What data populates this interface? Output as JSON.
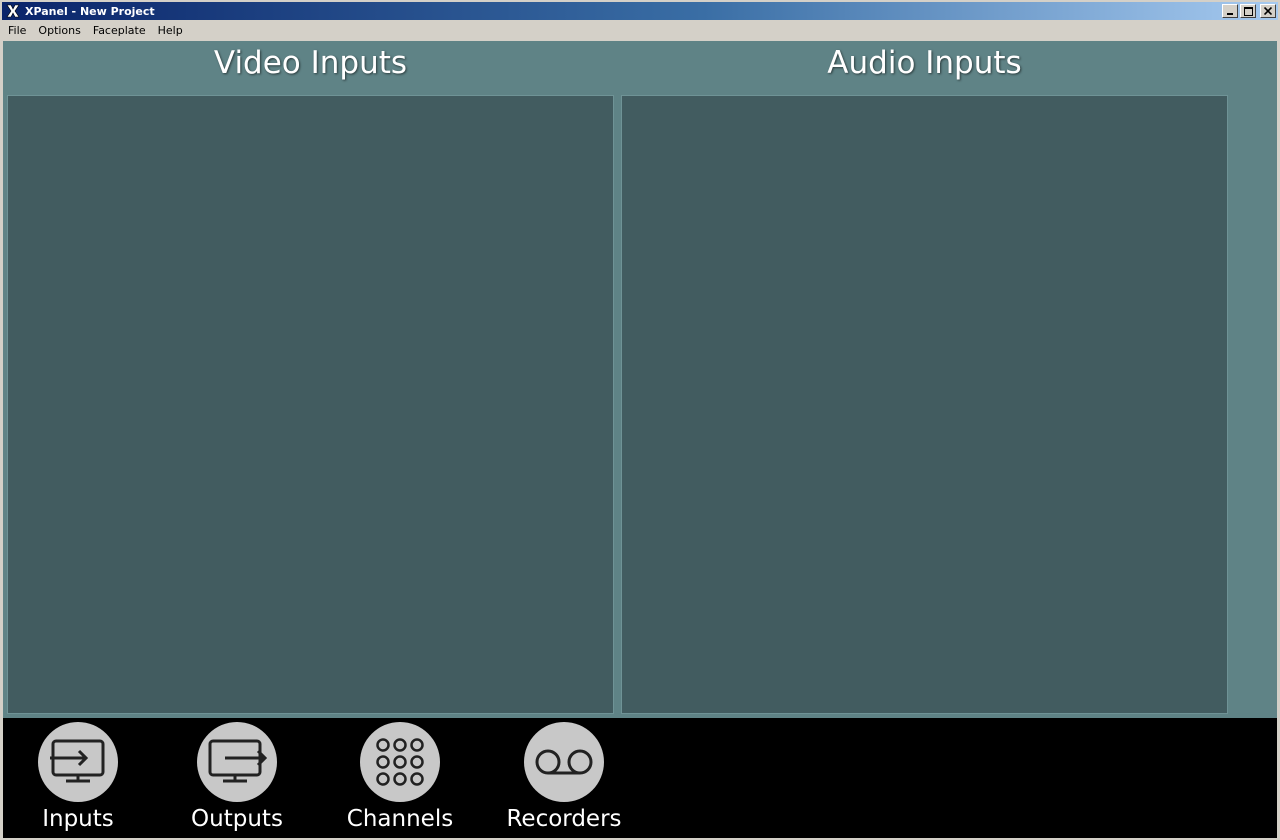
{
  "window": {
    "title": "XPanel - New Project",
    "icon": "x-logo-icon",
    "controls": [
      "minimize-icon",
      "maximize-icon",
      "close-icon"
    ]
  },
  "menu": {
    "items": [
      "File",
      "Options",
      "Faceplate",
      "Help"
    ]
  },
  "panels": {
    "video": {
      "title": "Video Inputs"
    },
    "audio": {
      "title": "Audio Inputs"
    }
  },
  "nav": {
    "buttons": [
      {
        "label": "Inputs",
        "icon": "monitor-input-icon"
      },
      {
        "label": "Outputs",
        "icon": "monitor-output-icon"
      },
      {
        "label": "Channels",
        "icon": "keypad-grid-icon"
      },
      {
        "label": "Recorders",
        "icon": "voicemail-tape-icon"
      }
    ]
  },
  "colors": {
    "titlebar_start": "#0a246a",
    "titlebar_end": "#a6caf0",
    "chrome": "#d4d0c8",
    "client_bg": "#5f8386",
    "panel_bg": "#425c60",
    "nav_bg": "#000000",
    "nav_circle": "#c8c8c8"
  }
}
